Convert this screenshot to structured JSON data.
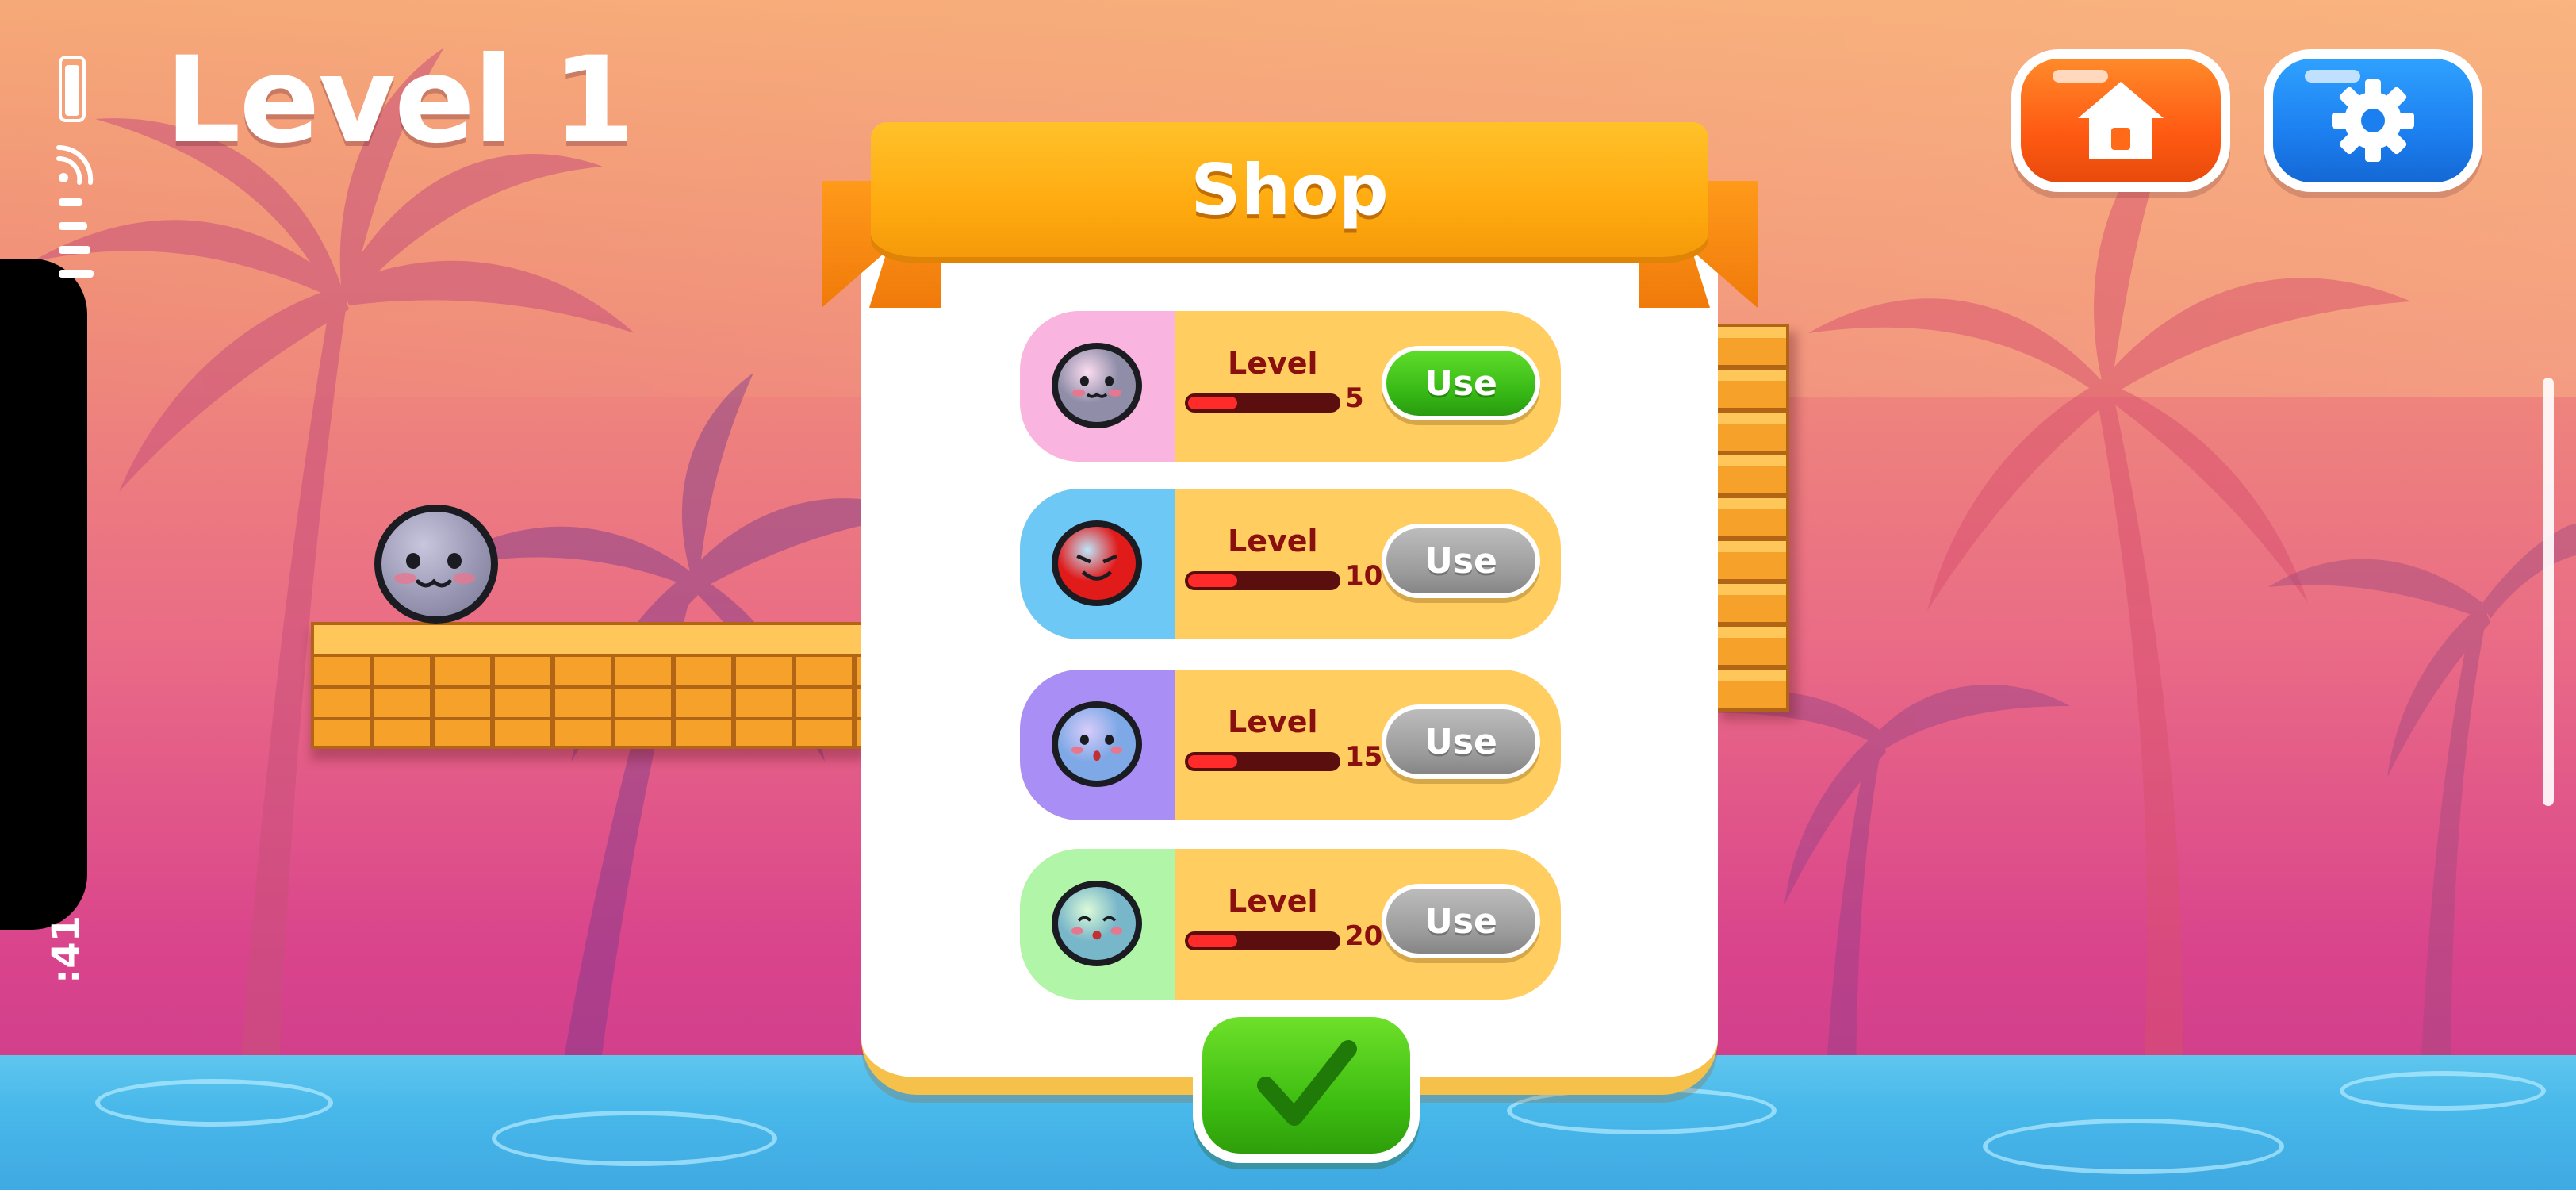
{
  "hud": {
    "level_title": "Level 1",
    "clock": ":41",
    "home_icon": "home-icon",
    "settings_icon": "gear-icon"
  },
  "shop": {
    "title": "Shop",
    "confirm_icon": "checkmark-icon",
    "items": [
      {
        "level_label": "Level",
        "required_level": "5",
        "button_label": "Use",
        "unlocked": true,
        "swatch_color": "#f9b4e0",
        "ball_color": "#8f8da8",
        "progress": 0.33
      },
      {
        "level_label": "Level",
        "required_level": "10",
        "button_label": "Use",
        "unlocked": false,
        "swatch_color": "#6ec8f6",
        "ball_color": "#e11a1a",
        "progress": 0.33
      },
      {
        "level_label": "Level",
        "required_level": "15",
        "button_label": "Use",
        "unlocked": false,
        "swatch_color": "#a98ef5",
        "ball_color": "#7fa9e6",
        "progress": 0.33
      },
      {
        "level_label": "Level",
        "required_level": "20",
        "button_label": "Use",
        "unlocked": false,
        "swatch_color": "#b0f5a8",
        "ball_color": "#78b6c9",
        "progress": 0.33
      }
    ]
  }
}
